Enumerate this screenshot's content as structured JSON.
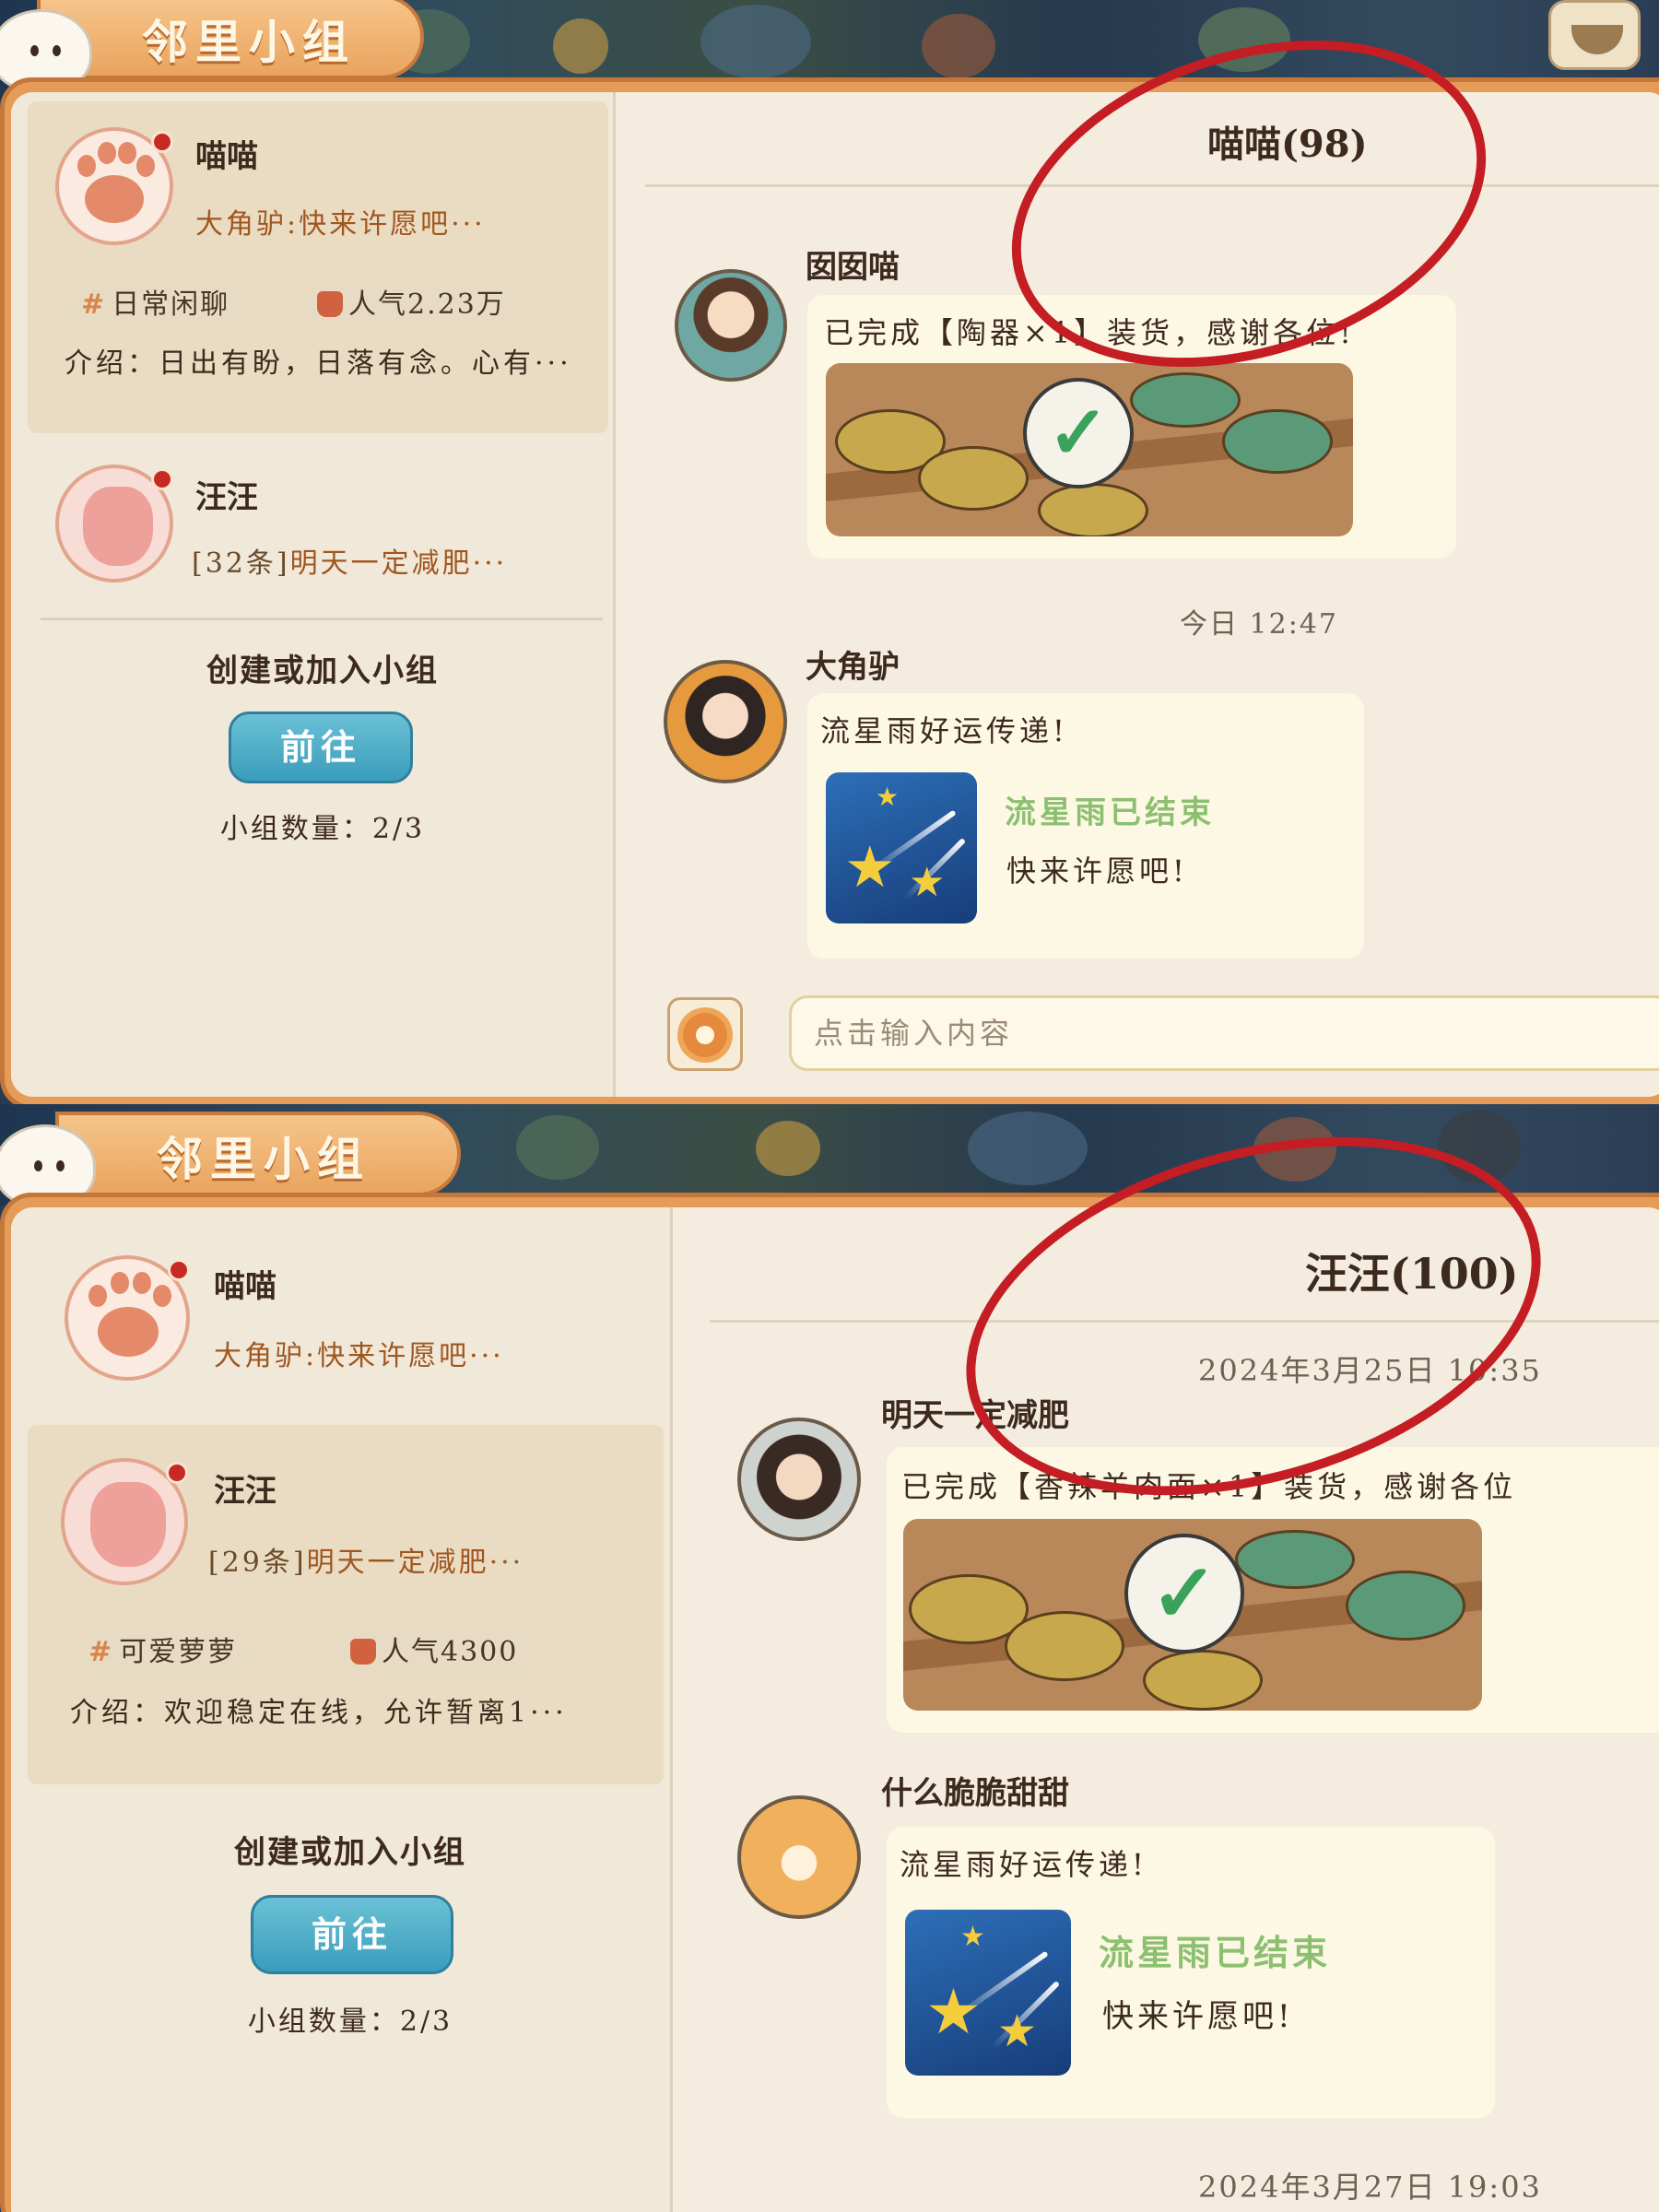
{
  "screens": [
    {
      "header_title": "邻里小组",
      "groups": [
        {
          "name": "喵喵",
          "last_message": "大角驴:快来许愿吧···",
          "tags": [
            "日常闲聊",
            "人气2.23万"
          ],
          "intro": "介绍：日出有盼，日落有念。心有···"
        },
        {
          "name": "汪汪",
          "last_message_count": "[32条]",
          "last_message": "明天一定减肥···"
        }
      ],
      "create_title": "创建或加入小组",
      "go_button": "前往",
      "group_count": "小组数量：2/3",
      "chat_title": "喵喵(98)",
      "messages": [
        {
          "sender": "囡囡喵",
          "text": "已完成【陶器×1】装货，感谢各位!"
        },
        {
          "sender": "大角驴",
          "text": "流星雨好运传递!",
          "card_title": "流星雨已结束",
          "card_subtitle": "快来许愿吧!"
        }
      ],
      "timestamp": "今日 12:47",
      "input_placeholder": "点击输入内容"
    },
    {
      "header_title": "邻里小组",
      "groups": [
        {
          "name": "喵喵",
          "last_message": "大角驴:快来许愿吧···"
        },
        {
          "name": "汪汪",
          "last_message_count": "[29条]",
          "last_message": "明天一定减肥···",
          "tags": [
            "可爱萝萝",
            "人气4300"
          ],
          "intro": "介绍：欢迎稳定在线，允许暂离1···"
        }
      ],
      "create_title": "创建或加入小组",
      "go_button": "前往",
      "group_count": "小组数量：2/3",
      "chat_title": "汪汪(100)",
      "timestamps": [
        "2024年3月25日 10:35",
        "2024年3月27日 19:03"
      ],
      "messages": [
        {
          "sender": "明天一定减肥",
          "text": "已完成【香辣羊肉面×1】装货，感谢各位"
        },
        {
          "sender": "什么脆脆甜甜",
          "text": "流星雨好运传递!",
          "card_title": "流星雨已结束",
          "card_subtitle": "快来许愿吧!"
        }
      ]
    }
  ],
  "icons": [
    "ghost-mascot-icon",
    "paw-icon",
    "hash-icon",
    "thumbs-up-icon",
    "checkmark-icon",
    "shooting-star-icon",
    "flower-settings-icon",
    "bowl-icon"
  ],
  "colors": {
    "highlight_circle": "#c41d24",
    "go_button": "#3a9dbc",
    "meteor_title": "#8cc070",
    "unread_dot": "#c62a22"
  }
}
